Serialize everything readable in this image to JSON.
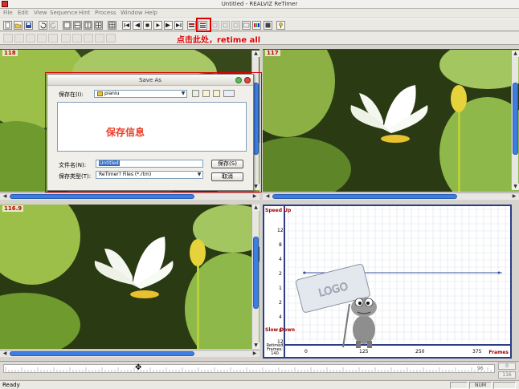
{
  "window": {
    "title": "Untitled - REALVIZ ReTimer"
  },
  "menu": [
    "File",
    "Edit",
    "View",
    "Sequence",
    "Hint",
    "Process",
    "Window",
    "Help"
  ],
  "annotation": "点击此处，retime all",
  "panes": {
    "top_left_label": "118",
    "top_right_label": "117",
    "bottom_left_label": "116.9"
  },
  "dialog": {
    "title": "Save As",
    "save_in_label": "保存在(I):",
    "folder": "pianiu",
    "info_text": "保存信息",
    "filename_label": "文件名(N):",
    "filename_value": "Untitled",
    "filetype_label": "保存类型(T):",
    "filetype_value": "ReTimer? Files (*.rtm)",
    "save_button": "保存(S)",
    "cancel_button": "取消"
  },
  "graph": {
    "speed_up": "Speed Up",
    "slow_down": "Slow Down",
    "y_ticks": [
      "12",
      "8",
      "4",
      "2",
      "1",
      "2",
      "4",
      "8",
      "12"
    ],
    "retimed_frames": "Retimed Frames: 140",
    "x_ticks": [
      "0",
      "125",
      "250",
      "375"
    ],
    "frames_label": "Frames",
    "logo_text": "LOGO"
  },
  "timeline": {
    "ruler_numbers": [
      "96"
    ],
    "right_values": [
      "0",
      "116"
    ]
  },
  "status": {
    "text": "Ready",
    "num": "NUM"
  }
}
